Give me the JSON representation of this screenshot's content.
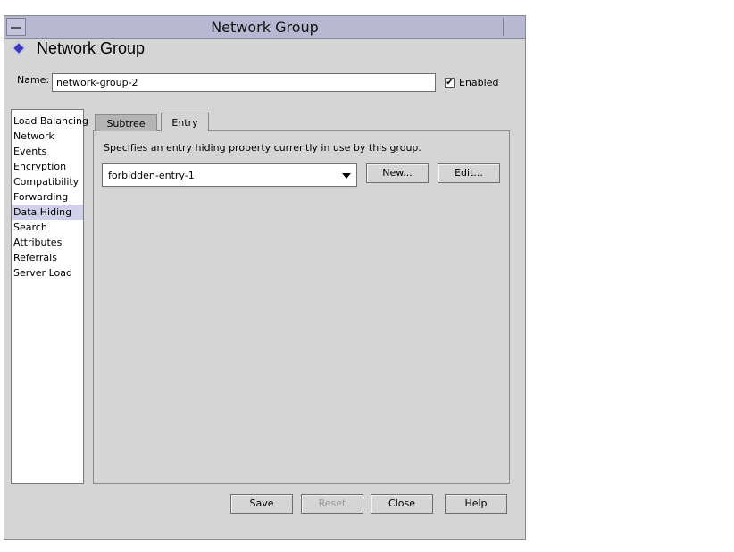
{
  "window": {
    "title": "Network Group"
  },
  "header": {
    "title": "Network Group"
  },
  "name_field": {
    "label": "Name:",
    "value": "network-group-2"
  },
  "enabled": {
    "label": "Enabled",
    "checked": true
  },
  "nav": {
    "items": [
      {
        "label": "Load Balancing"
      },
      {
        "label": "Network"
      },
      {
        "label": "Events"
      },
      {
        "label": "Encryption"
      },
      {
        "label": "Compatibility"
      },
      {
        "label": "Forwarding"
      },
      {
        "label": "Data Hiding",
        "selected": true
      },
      {
        "label": "Search"
      },
      {
        "label": "Attributes"
      },
      {
        "label": "Referrals"
      },
      {
        "label": "Server Load"
      }
    ]
  },
  "tabs": [
    {
      "label": "Subtree"
    },
    {
      "label": "Entry",
      "active": true
    }
  ],
  "entry_panel": {
    "description": "Specifies an entry hiding property currently in use by this group.",
    "selected": "forbidden-entry-1",
    "new_label": "New...",
    "edit_label": "Edit..."
  },
  "footer": {
    "save": "Save",
    "reset": "Reset",
    "close": "Close",
    "help": "Help"
  },
  "colors": {
    "titlebar": "#b8b8d2",
    "selected_nav": "#d0d0ea",
    "accent_icon": "#3b3bb8"
  },
  "icons": {
    "header": "diamond-icon",
    "window_menu": "window-menu-icon",
    "combo": "dropdown-arrow-icon"
  }
}
